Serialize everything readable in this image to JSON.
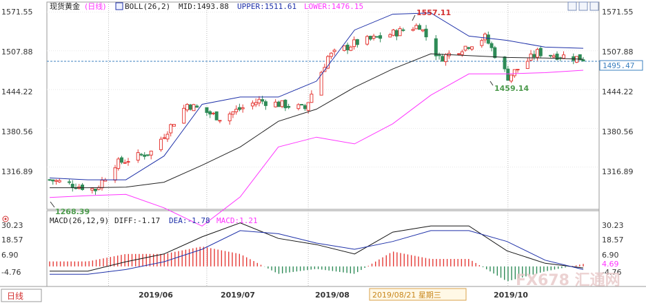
{
  "header": {
    "instrument": "现货黄金",
    "period": "(日线)",
    "indicator": "BOLL(26,2)",
    "mid": "MID:1493.88",
    "upper": "UPPER:1511.61",
    "lower": "LOWER:1476.15"
  },
  "macd_header": {
    "name": "MACD(26,12,9)",
    "diff": "DIFF:-1.17",
    "dea": "DEA:-1.78",
    "macd": "MACD:1.21"
  },
  "price_axis": {
    "ticks": [
      "1571.55",
      "1507.88",
      "1444.22",
      "1380.56",
      "1316.89"
    ],
    "current": "1495.47"
  },
  "macd_axis": {
    "ticks": [
      "30.23",
      "18.57",
      "6.90",
      "-4.76"
    ],
    "current": "4.69"
  },
  "annotations": {
    "high": "1557.11",
    "low_recent": "1459.14",
    "low_start": "1268.39"
  },
  "xaxis": {
    "labels": [
      "2019/06",
      "2019/07",
      "2019/08",
      "2019/10"
    ],
    "cursor_date": "2019/08/21  星期三"
  },
  "period_tab": "日线",
  "watermark": "FX678 汇通网",
  "colors": {
    "up": "#e53935",
    "down": "#2e8b57",
    "boll_band": "#1c2fa8",
    "boll_mid": "#222222",
    "boll_lower": "#ff33ff",
    "macd_diff": "#111111",
    "macd_dea": "#1c2fa8",
    "grid": "#b8b8b8",
    "current_line": "#3a7fbf"
  },
  "chart_data": {
    "type": "candlestick",
    "x_range": [
      "2019-05-14",
      "2019-10-24"
    ],
    "ylim": [
      1252,
      1580
    ],
    "price_path": [
      {
        "date": "2019-05-14",
        "close": 1296
      },
      {
        "date": "2019-05-28",
        "close": 1280
      },
      {
        "date": "2019-06-03",
        "close": 1322
      },
      {
        "date": "2019-06-14",
        "close": 1342
      },
      {
        "date": "2019-06-25",
        "close": 1420
      },
      {
        "date": "2019-07-05",
        "close": 1398
      },
      {
        "date": "2019-07-17",
        "close": 1426
      },
      {
        "date": "2019-07-31",
        "close": 1413
      },
      {
        "date": "2019-08-07",
        "close": 1498
      },
      {
        "date": "2019-08-15",
        "close": 1520
      },
      {
        "date": "2019-08-23",
        "close": 1530
      },
      {
        "date": "2019-09-04",
        "close": 1550
      },
      {
        "date": "2019-09-10",
        "close": 1495
      },
      {
        "date": "2019-09-24",
        "close": 1530
      },
      {
        "date": "2019-10-01",
        "close": 1465
      },
      {
        "date": "2019-10-10",
        "close": 1505
      },
      {
        "date": "2019-10-24",
        "close": 1495
      }
    ],
    "boll_upper": [
      1299,
      1296,
      1296,
      1335,
      1420,
      1432,
      1432,
      1458,
      1542,
      1568,
      1570,
      1532,
      1525,
      1514,
      1512
    ],
    "boll_mid": [
      1283,
      1283,
      1284,
      1292,
      1320,
      1350,
      1392,
      1412,
      1448,
      1478,
      1503,
      1500,
      1497,
      1496,
      1494
    ],
    "boll_lower": [
      1267,
      1270,
      1272,
      1250,
      1220,
      1268,
      1350,
      1366,
      1355,
      1388,
      1435,
      1470,
      1470,
      1472,
      1476
    ],
    "macd": {
      "ylim": [
        -12,
        34
      ],
      "diff": [
        -3,
        -3,
        3,
        8,
        19,
        28,
        18,
        14,
        8,
        22,
        26,
        26,
        10,
        2,
        -1
      ],
      "dea": [
        -5,
        -5,
        -2,
        3,
        11,
        23,
        21,
        15,
        11,
        16,
        23,
        23,
        16,
        4,
        -2
      ]
    }
  }
}
